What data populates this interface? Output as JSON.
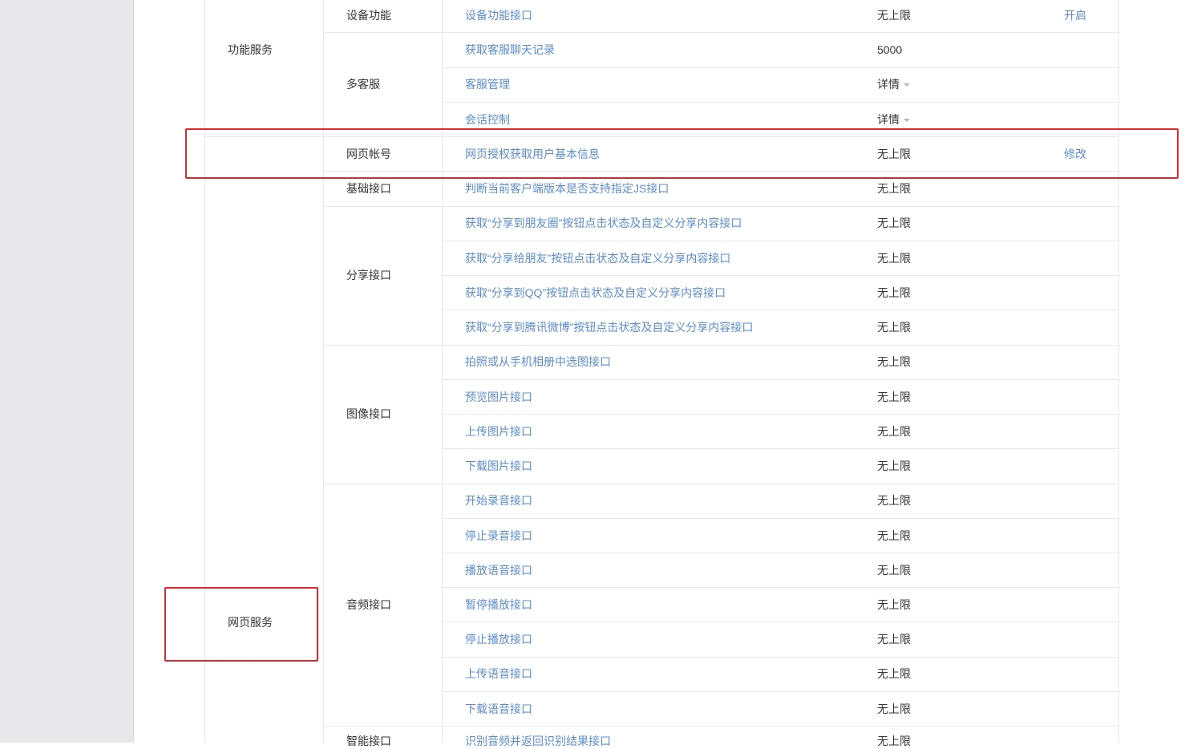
{
  "categories": [
    {
      "label": "功能服务"
    },
    {
      "label": "网页服务"
    }
  ],
  "groups": [
    {
      "label": "设备功能"
    },
    {
      "label": "多客服"
    },
    {
      "label": "网页帐号"
    },
    {
      "label": "基础接口"
    },
    {
      "label": "分享接口"
    },
    {
      "label": "图像接口"
    },
    {
      "label": "音频接口"
    },
    {
      "label": "智能接口"
    }
  ],
  "rows": [
    {
      "api": "设备功能接口",
      "quota": "无上限",
      "action": "开启"
    },
    {
      "api": "获取客服聊天记录",
      "quota": "5000",
      "action": ""
    },
    {
      "api": "客服管理",
      "quota": "详情",
      "action": ""
    },
    {
      "api": "会话控制",
      "quota": "详情",
      "action": ""
    },
    {
      "api": "网页授权获取用户基本信息",
      "quota": "无上限",
      "action": "修改"
    },
    {
      "api": "判断当前客户端版本是否支持指定JS接口",
      "quota": "无上限",
      "action": ""
    },
    {
      "api": "获取“分享到朋友圈”按钮点击状态及自定义分享内容接口",
      "quota": "无上限",
      "action": ""
    },
    {
      "api": "获取“分享给朋友”按钮点击状态及自定义分享内容接口",
      "quota": "无上限",
      "action": ""
    },
    {
      "api": "获取“分享到QQ”按钮点击状态及自定义分享内容接口",
      "quota": "无上限",
      "action": ""
    },
    {
      "api": "获取“分享到腾讯微博”按钮点击状态及自定义分享内容接口",
      "quota": "无上限",
      "action": ""
    },
    {
      "api": "拍照或从手机相册中选图接口",
      "quota": "无上限",
      "action": ""
    },
    {
      "api": "预览图片接口",
      "quota": "无上限",
      "action": ""
    },
    {
      "api": "上传图片接口",
      "quota": "无上限",
      "action": ""
    },
    {
      "api": "下载图片接口",
      "quota": "无上限",
      "action": ""
    },
    {
      "api": "开始录音接口",
      "quota": "无上限",
      "action": ""
    },
    {
      "api": "停止录音接口",
      "quota": "无上限",
      "action": ""
    },
    {
      "api": "播放语音接口",
      "quota": "无上限",
      "action": ""
    },
    {
      "api": "暂停播放接口",
      "quota": "无上限",
      "action": ""
    },
    {
      "api": "停止播放接口",
      "quota": "无上限",
      "action": ""
    },
    {
      "api": "上传语音接口",
      "quota": "无上限",
      "action": ""
    },
    {
      "api": "下载语音接口",
      "quota": "无上限",
      "action": ""
    },
    {
      "api": "识别音频并返回识别结果接口",
      "quota": "无上限",
      "action": ""
    }
  ],
  "colors": {
    "link": "#5b8dcd",
    "highlight": "#e3262b",
    "sidebar": "#e7e8eb"
  }
}
